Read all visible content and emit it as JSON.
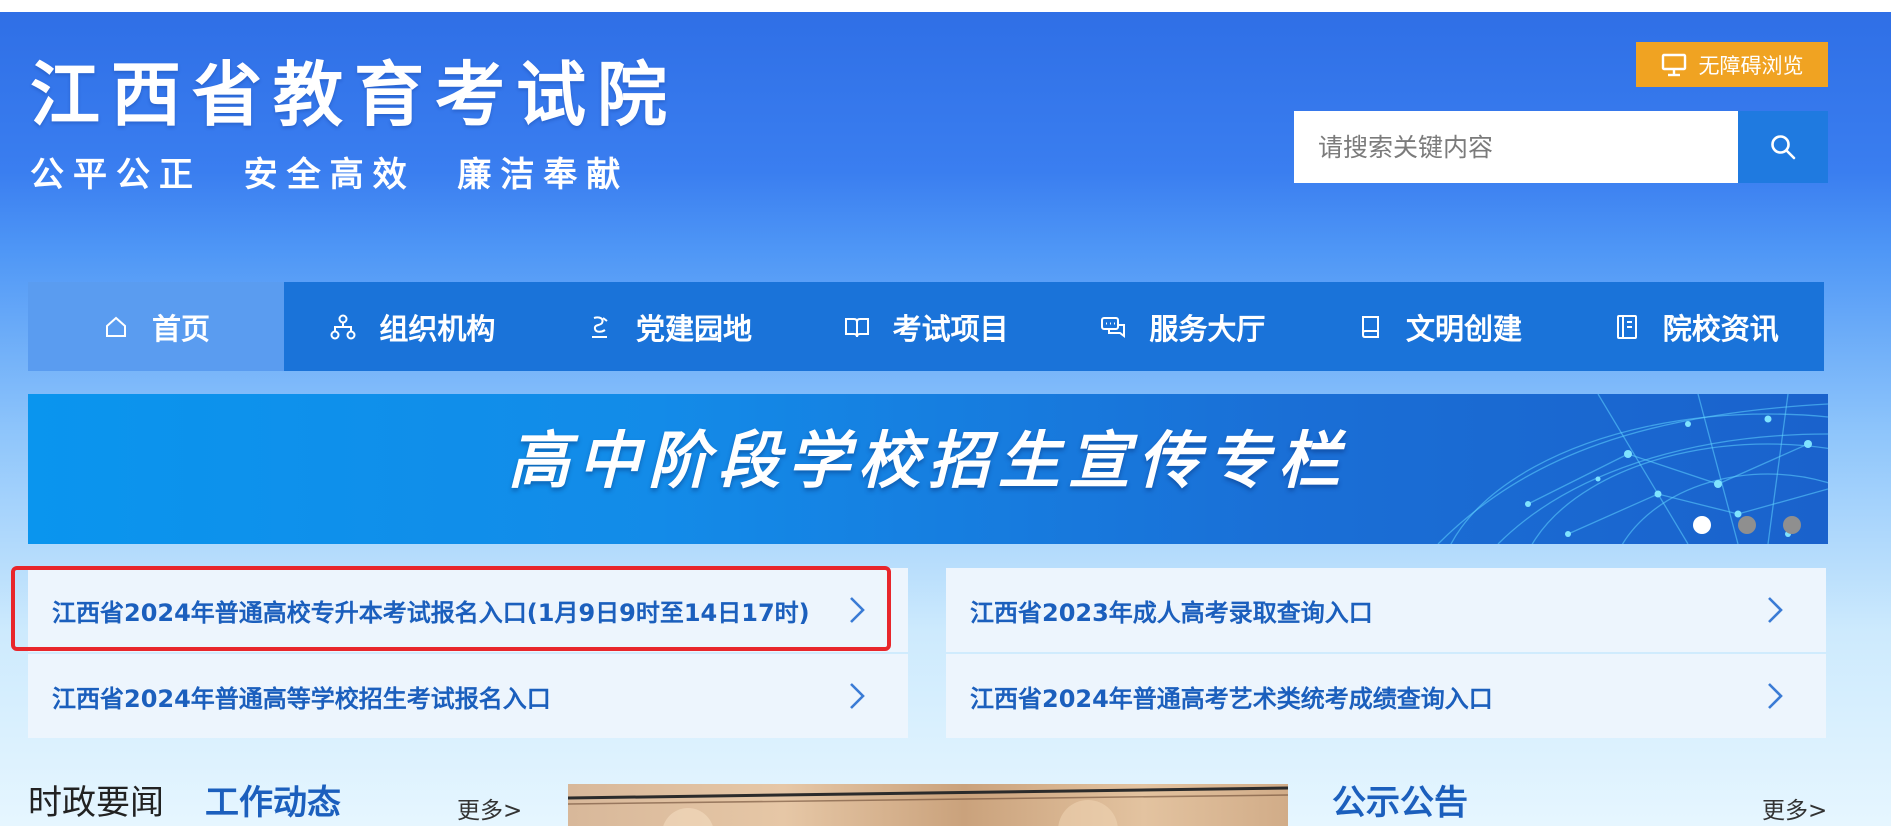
{
  "header": {
    "site_title": "江西省教育考试院",
    "slogan": "公平公正  安全高效  廉洁奉献",
    "accessibility_label": "无障碍浏览",
    "search_placeholder": "请搜索关键内容"
  },
  "nav": {
    "items": [
      {
        "label": "首页",
        "icon": "home-icon"
      },
      {
        "label": "组织机构",
        "icon": "org-structure-icon"
      },
      {
        "label": "党建园地",
        "icon": "party-building-icon"
      },
      {
        "label": "考试项目",
        "icon": "book-open-icon"
      },
      {
        "label": "服务大厅",
        "icon": "chat-service-icon"
      },
      {
        "label": "文明创建",
        "icon": "notebook-icon"
      },
      {
        "label": "院校资讯",
        "icon": "document-icon"
      }
    ]
  },
  "banner": {
    "title": "高中阶段学校招生宣传专栏",
    "slide_count": 3,
    "active_slide": 0
  },
  "quick_links": [
    {
      "text": "江西省2024年普通高校专升本考试报名入口(1月9日9时至14日17时)"
    },
    {
      "text": "江西省2023年成人高考录取查询入口"
    },
    {
      "text": "江西省2024年普通高等学校招生考试报名入口"
    },
    {
      "text": "江西省2024年普通高考艺术类统考成绩查询入口"
    }
  ],
  "sections": {
    "news_tab_1": "时政要闻",
    "news_tab_2": "工作动态",
    "news_more": "更多>",
    "notice_title": "公示公告",
    "notice_more": "更多>"
  },
  "colors": {
    "header_blue": "#2f6fe6",
    "nav_blue": "#1a73d9",
    "nav_active": "#5a9cf0",
    "accessibility_orange": "#f0a322",
    "link_text_blue": "#1b5fbd",
    "highlight_red": "#e8262b"
  }
}
